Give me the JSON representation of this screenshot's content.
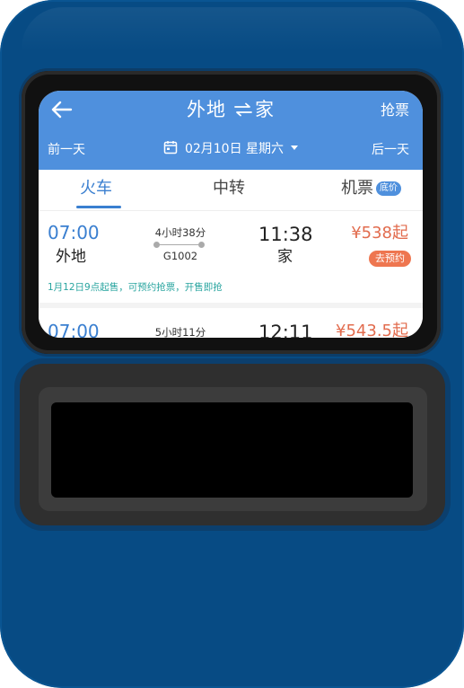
{
  "header": {
    "title_from": "外地",
    "title_to": "家",
    "grab_ticket": "抢票",
    "prev_day": "前一天",
    "next_day": "后一天",
    "date": "02月10日 星期六"
  },
  "tabs": [
    {
      "label": "火车",
      "active": true
    },
    {
      "label": "中转",
      "active": false
    },
    {
      "label": "机票",
      "badge": "底价",
      "active": false
    }
  ],
  "results": [
    {
      "depart_time": "07:00",
      "depart_city": "外地",
      "duration": "4小时38分",
      "train_no": "G1002",
      "arrive_time": "11:38",
      "arrive_city": "家",
      "price": "¥538起",
      "action": "去预约",
      "notice": "1月12日9点起售，可预约抢票，开售即抢"
    },
    {
      "depart_time": "07:00",
      "duration": "5小时11分",
      "arrive_time": "12:11",
      "price": "¥543.5起"
    }
  ],
  "colors": {
    "device": "#074b84",
    "header": "#4f90dd",
    "accent": "#3a7fd0",
    "price": "#e26c4e",
    "notice": "#2aa5a0"
  }
}
